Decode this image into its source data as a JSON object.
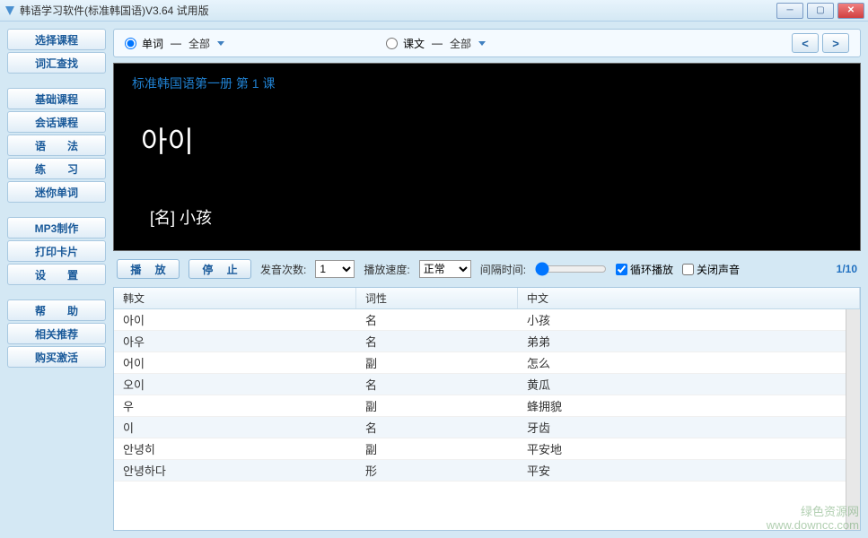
{
  "window": {
    "title": "韩语学习软件(标准韩国语)V3.64 试用版"
  },
  "sidebar": {
    "group1": [
      {
        "label": "选择课程"
      },
      {
        "label": "词汇查找"
      }
    ],
    "group2": [
      {
        "label": "基础课程"
      },
      {
        "label": "会话课程"
      },
      {
        "label": "语　　法"
      },
      {
        "label": "练　　习"
      },
      {
        "label": "迷你单词"
      }
    ],
    "group3": [
      {
        "label": "MP3制作"
      },
      {
        "label": "打印卡片"
      },
      {
        "label": "设　　置"
      }
    ],
    "group4": [
      {
        "label": "帮　　助"
      },
      {
        "label": "相关推荐"
      },
      {
        "label": "购买激活"
      }
    ]
  },
  "filter": {
    "radio1_label": "单词",
    "radio1_scope": "全部",
    "radio2_label": "课文",
    "radio2_scope": "全部"
  },
  "display": {
    "lesson_title": "标准韩国语第一册 第 1 课",
    "korean": "아이",
    "meaning": "[名] 小孩"
  },
  "controls": {
    "play": "播 放",
    "stop": "停 止",
    "count_label": "发音次数:",
    "count_value": "1",
    "speed_label": "播放速度:",
    "speed_value": "正常",
    "interval_label": "间隔时间:",
    "loop_label": "循环播放",
    "mute_label": "关闭声音",
    "page_indicator": "1/10"
  },
  "table": {
    "headers": {
      "korean": "韩文",
      "pos": "词性",
      "chinese": "中文"
    },
    "rows": [
      {
        "kr": "아이",
        "pos": "名",
        "cn": "小孩"
      },
      {
        "kr": "아우",
        "pos": "名",
        "cn": "弟弟"
      },
      {
        "kr": "어이",
        "pos": "副",
        "cn": "怎么"
      },
      {
        "kr": "오이",
        "pos": "名",
        "cn": "黄瓜"
      },
      {
        "kr": "우",
        "pos": "副",
        "cn": "蜂拥貌"
      },
      {
        "kr": "이",
        "pos": "名",
        "cn": "牙齿"
      },
      {
        "kr": "안녕히",
        "pos": "副",
        "cn": "平安地"
      },
      {
        "kr": "안녕하다",
        "pos": "形",
        "cn": "平安"
      }
    ]
  },
  "watermark": {
    "line1": "绿色资源网",
    "line2": "www.downcc.com"
  }
}
